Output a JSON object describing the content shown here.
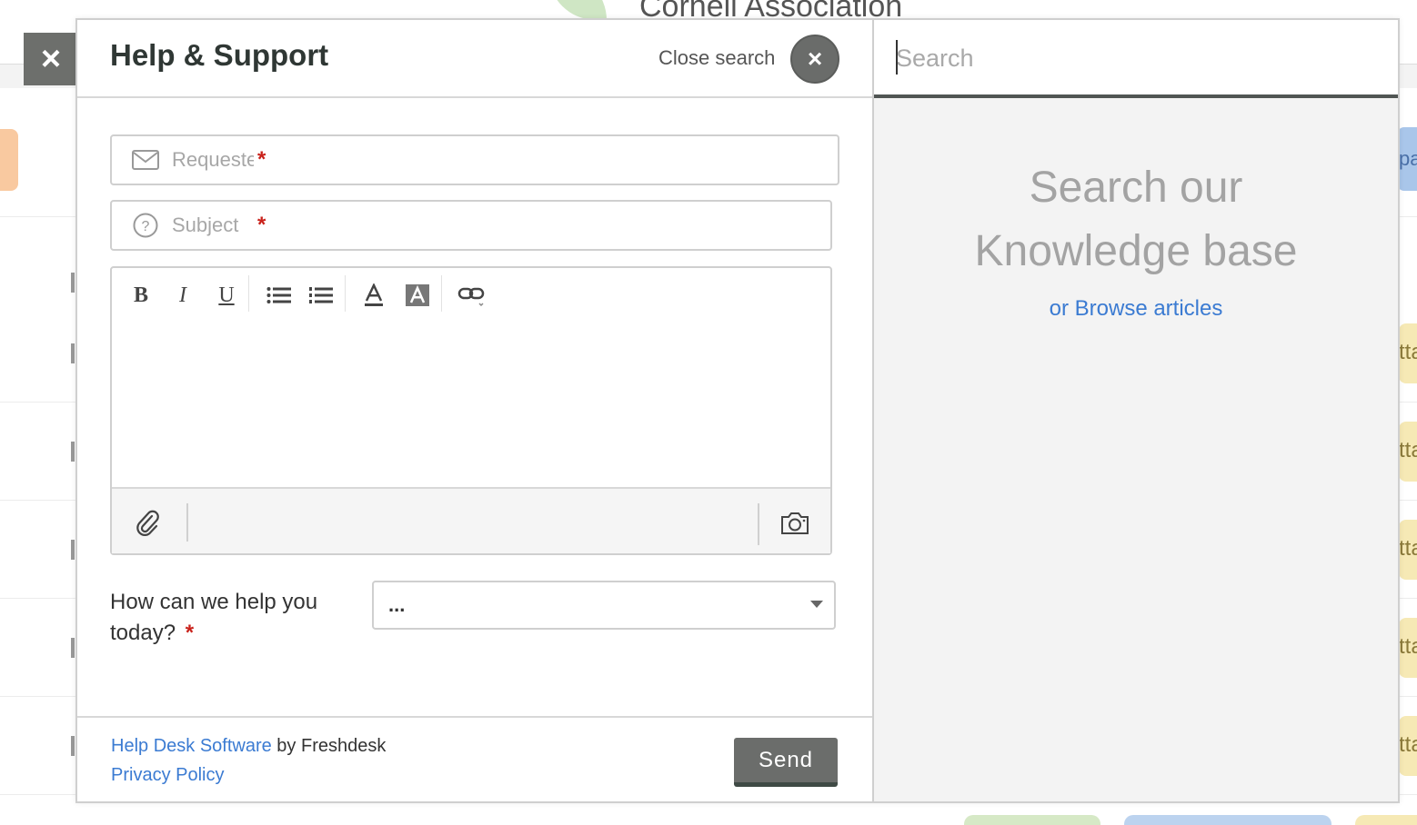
{
  "background": {
    "org_title": "Cornell Association",
    "right_blue_text": "pa",
    "right_tag_text": "tta"
  },
  "widget": {
    "title": "Help & Support",
    "close_search_label": "Close search",
    "close_glyph": "×",
    "outer_close_glyph": "×",
    "requester_placeholder": "Requester",
    "subject_placeholder": "Subject",
    "required_mark": "*",
    "toolbar": {
      "bold": "B",
      "italic": "I",
      "underline": "U"
    },
    "icons": {
      "requester": "envelope-icon",
      "subject": "question-circle-icon",
      "attach": "paperclip-icon",
      "camera": "camera-icon",
      "bullet_list": "bullet-list-icon",
      "numbered_list": "numbered-list-icon",
      "font_color": "font-color-icon",
      "highlight": "highlight-icon",
      "link": "link-icon",
      "dropdown": "caret-down-icon"
    },
    "help_question": "How can we help you today?",
    "help_select_value": "...",
    "footer": {
      "software_link": "Help Desk Software",
      "by_text": " by Freshdesk",
      "privacy_link": "Privacy Policy"
    },
    "send_label": "Send"
  },
  "knowledge": {
    "search_placeholder": "Search",
    "title_line1": "Search our",
    "title_line2": "Knowledge base",
    "browse_link": "or Browse articles"
  },
  "colors": {
    "link": "#3b7bd2",
    "required": "#c9221b",
    "button_gray": "#6b6d6b"
  }
}
